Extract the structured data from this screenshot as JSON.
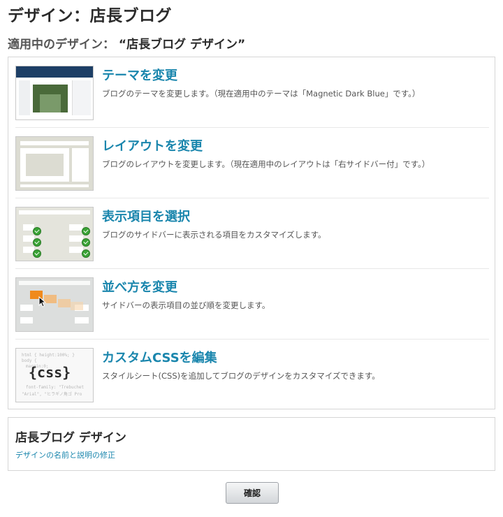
{
  "page": {
    "title": "デザイン：店長ブログ",
    "current_label": "適用中のデザイン：",
    "current_name": "“店長ブログ デザイン”"
  },
  "options": [
    {
      "title": "テーマを変更",
      "desc": "ブログのテーマを変更します。（現在適用中のテーマは「Magnetic Dark Blue」です。）",
      "icon": "theme-thumbnail"
    },
    {
      "title": "レイアウトを変更",
      "desc": "ブログのレイアウトを変更します。（現在適用中のレイアウトは「右サイドバー付」です。）",
      "icon": "layout-thumbnail"
    },
    {
      "title": "表示項目を選択",
      "desc": "ブログのサイドバーに表示される項目をカスタマイズします。",
      "icon": "widgets-thumbnail"
    },
    {
      "title": "並べ方を変更",
      "desc": "サイドバーの表示項目の並び順を変更します。",
      "icon": "reorder-thumbnail"
    },
    {
      "title": "カスタムCSSを編集",
      "desc": "スタイルシート(CSS)を追加してブログのデザインをカスタマイズできます。",
      "icon": "css-thumbnail",
      "thumb_text": "{css}"
    }
  ],
  "design": {
    "name": "店長ブログ デザイン",
    "edit_link": "デザインの名前と説明の修正"
  },
  "confirm_button": "確認",
  "colors": {
    "link": "#1a86ad",
    "border": "#d6d6d6",
    "title": "#2b2b2b"
  }
}
